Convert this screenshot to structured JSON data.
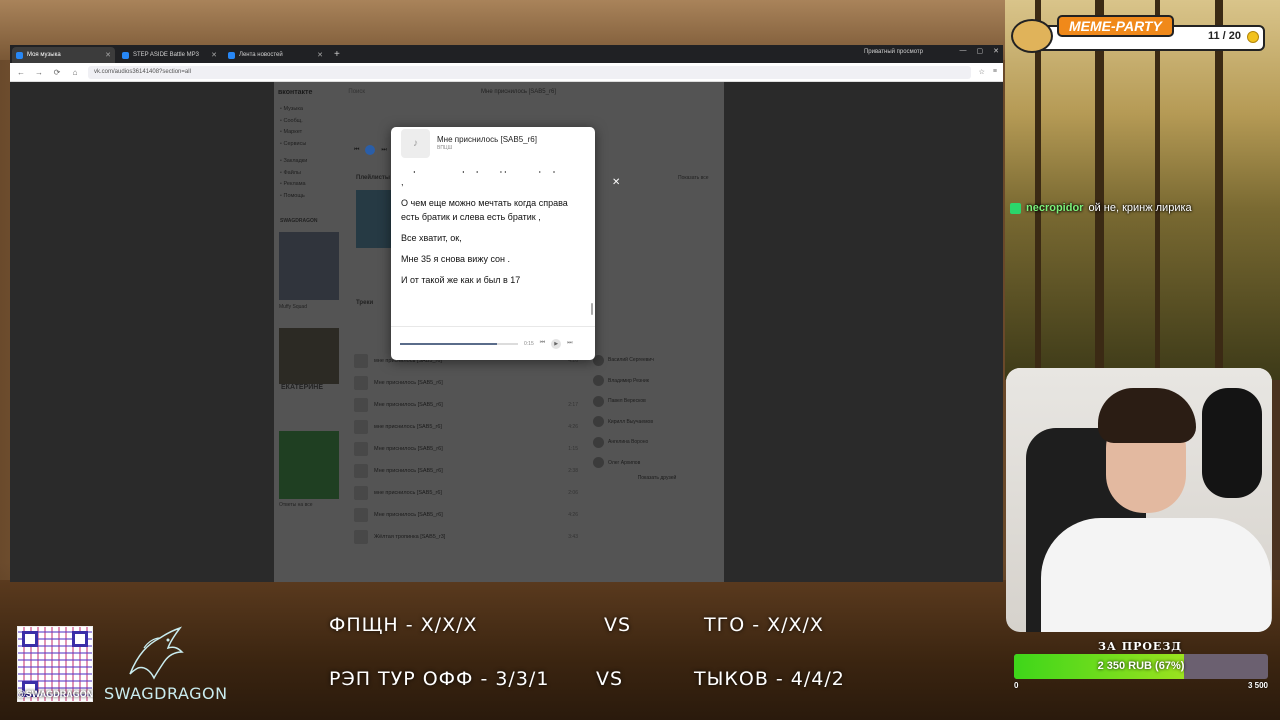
{
  "browser": {
    "tabs": [
      {
        "label": "Моя музыка",
        "active": true
      },
      {
        "label": "STEP ASIDE Battle MP3",
        "active": false
      },
      {
        "label": "Лента новостей",
        "active": false
      }
    ],
    "private_label": "Приватный просмотр",
    "url": "vk.com/audios36141408?section=all"
  },
  "vk": {
    "logo": "вконтакте",
    "search_placeholder": "Поиск",
    "header_track": "Мне приснилось [SAB5_r6]",
    "menu": [
      "Музыка",
      "Сообщ.",
      "Маркет",
      "Сервисы",
      "Закладки",
      "Файлы",
      "Реклама",
      "Помощь"
    ],
    "section_playlists": "Плейлисты",
    "section_tracks": "Треки",
    "show_all": "Показать все",
    "show_friends": "Показать друзей",
    "sidebar_brand": "SWAGDRAGON",
    "sidebar_texts": [
      "Muffy Squad",
      "ЕКАТЕРИНЕ",
      "Колба имба от лучших",
      "Ответы на все"
    ],
    "tracks": [
      {
        "title": "мне приснилось [SAB5_r6]",
        "artist": "",
        "dur": "4:26"
      },
      {
        "title": "Мне приснилось [SAB5_r6]",
        "artist": "",
        "dur": ""
      },
      {
        "title": "Мне приснилось [SAB5_r6]",
        "artist": "",
        "dur": "2:17"
      },
      {
        "title": "мне приснилось [SAB5_r6]",
        "artist": "",
        "dur": "4:26"
      },
      {
        "title": "Мне приснилось [SAB5_r6]",
        "artist": "",
        "dur": "1:15"
      },
      {
        "title": "Мне приснилось [SAB5_r6]",
        "artist": "",
        "dur": "2:38"
      },
      {
        "title": "мне приснилось [SAB5_r6]",
        "artist": "",
        "dur": "2:06"
      },
      {
        "title": "Мне приснилось [SAB5_r6]",
        "artist": "",
        "dur": "4:26"
      },
      {
        "title": "Жёлтая тропинка [SAB5_r3]",
        "artist": "",
        "dur": "3:43"
      }
    ],
    "friends": [
      {
        "name": "Василий Сергеевич"
      },
      {
        "name": "Владимир Резник"
      },
      {
        "name": "Павел Вересков"
      },
      {
        "name": "Кирилл Выучаемов"
      },
      {
        "name": "Ангелина Вороно"
      },
      {
        "name": "Олег Архипов"
      }
    ]
  },
  "lyrics": {
    "title": "Мне приснилось [SAB5_r6]",
    "artist": "ВПЦШ",
    "lines": [
      "шарю какие картеры и где вообще брать их ,",
      "О чем еще можно мечтать когда справа есть братик и слева есть братик ,",
      "Все хватит, ок,",
      "Мне 35 я снова вижу сон .",
      "И от такой же как и был в 17"
    ],
    "time": "0:15",
    "progress": 0.82
  },
  "overlay": {
    "meme_title": "MEME-PARTY",
    "meme_count": "11 / 20",
    "chat_nick": "necropidor",
    "chat_msg": "ой не, кринж лирика",
    "donate_title": "ЗА ПРОЕЗД",
    "donate_value": "2 350 RUB (67%)",
    "donate_progress": 0.67,
    "donate_min": "0",
    "donate_max": "3 500",
    "qr_handle": "@SWAGDRAGON",
    "brand": "SWAGDRAGON",
    "scores": [
      {
        "left": "ФПЩН - Х/Х/Х",
        "vs": "VS",
        "right": "ТГО - Х/Х/Х"
      },
      {
        "left": "РЭП ТУР ОФФ - 3/3/1",
        "vs": "VS",
        "right": "ТЫКОВ - 4/4/2"
      }
    ]
  },
  "colors": {
    "accent": "#2787f5",
    "donate": "#3ed61a",
    "meme": "#f0891a"
  }
}
